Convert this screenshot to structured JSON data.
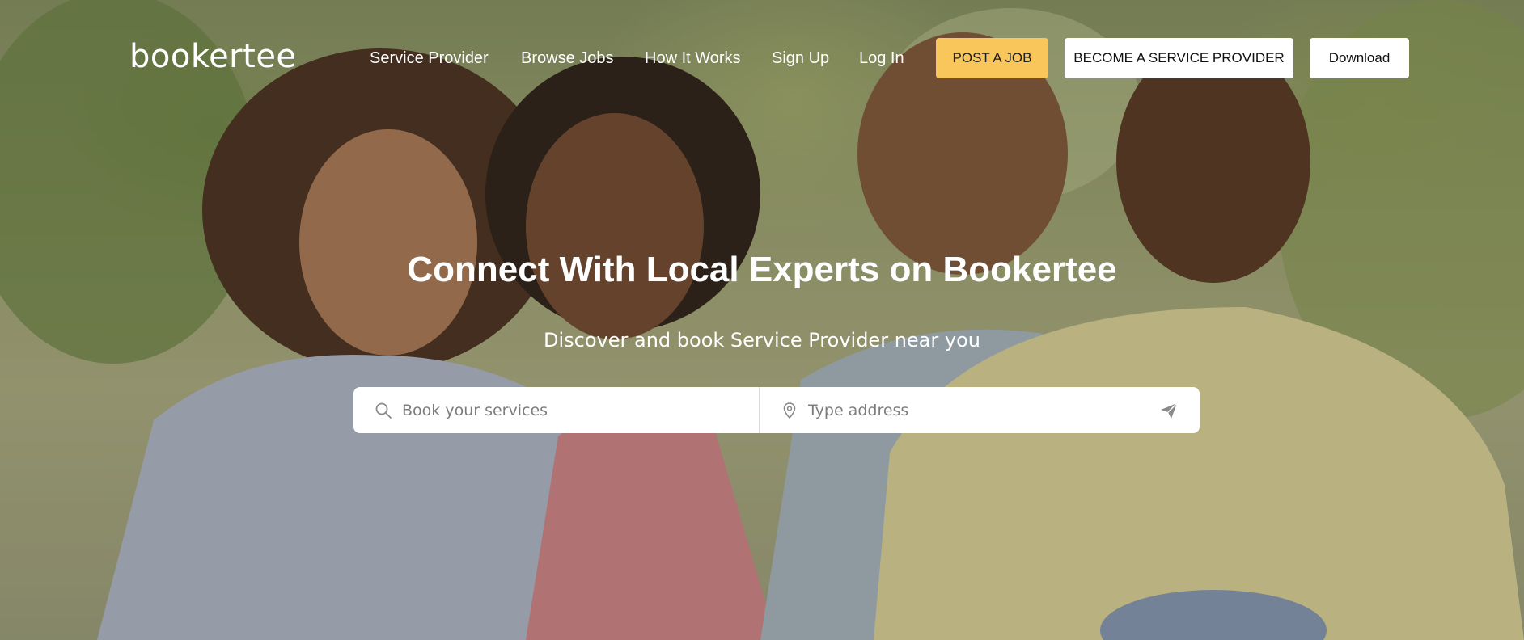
{
  "logo": {
    "text": "bookertee"
  },
  "nav": {
    "links": [
      {
        "label": "Service Provider"
      },
      {
        "label": "Browse Jobs"
      },
      {
        "label": "How It Works"
      },
      {
        "label": "Sign Up"
      },
      {
        "label": "Log In"
      }
    ],
    "post_job_label": "POST A JOB",
    "become_provider_label": "BECOME A SERVICE PROVIDER",
    "download_label": "Download"
  },
  "hero": {
    "title": "Connect With Local Experts on Bookertee",
    "subtitle": "Discover and book Service Provider near you"
  },
  "search": {
    "services_placeholder": "Book your services",
    "address_placeholder": "Type address"
  },
  "colors": {
    "accent": "#f9c65b",
    "button_bg": "#ffffff"
  },
  "icons": {
    "search": "search-icon",
    "location": "map-pin-icon",
    "send": "send-icon"
  }
}
